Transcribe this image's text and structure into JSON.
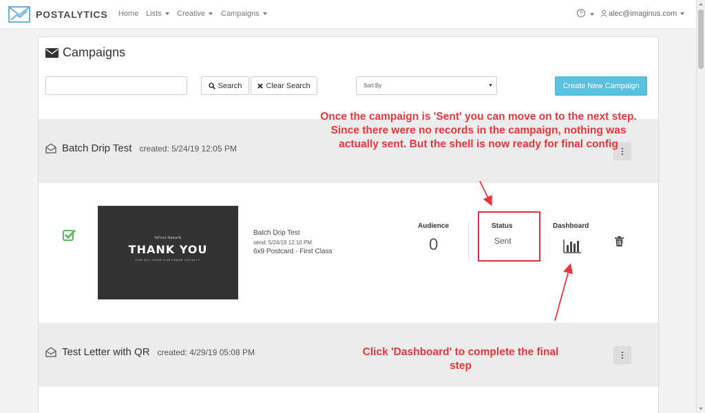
{
  "nav": {
    "brand": "POSTALYTICS",
    "home": "Home",
    "lists": "Lists",
    "creative": "Creative",
    "campaigns": "Campaigns",
    "help_icon": "?",
    "user": "alec@imaginus.com"
  },
  "page": {
    "title": "Campaigns",
    "search_placeholder": "",
    "search_button": "Search",
    "clear_button": "Clear Search",
    "sort_label": "Sort By",
    "create_button": "Create New Campaign"
  },
  "campaigns": [
    {
      "name": "Batch Drip Test",
      "created": "created: 5/24/19 12:05 PM",
      "thumbnail": {
        "first_name": "%First Name%",
        "headline": "THANK YOU",
        "tagline": "FOR ALL YOUR CUSTOMER LOYALTY"
      },
      "detail_name": "Batch Drip Test",
      "send": "send: 5/24/19 12:10 PM",
      "type": "6x9 Postcard - First Class",
      "audience_label": "Audience",
      "audience_value": "0",
      "status_label": "Status",
      "status_value": "Sent",
      "dashboard_label": "Dashboard"
    },
    {
      "name": "Test Letter with QR",
      "created": "created: 4/29/19 05:08 PM"
    }
  ],
  "annotations": {
    "top": "Once the campaign is 'Sent' you can move on to the next step. Since there were no records in the campaign, nothing was actually sent. But the shell is now ready for final config",
    "bottom": "Click 'Dashboard' to complete the final step"
  },
  "colors": {
    "accent": "#5bc0de",
    "annotation": "#e8353b",
    "check": "#5cb85c"
  }
}
